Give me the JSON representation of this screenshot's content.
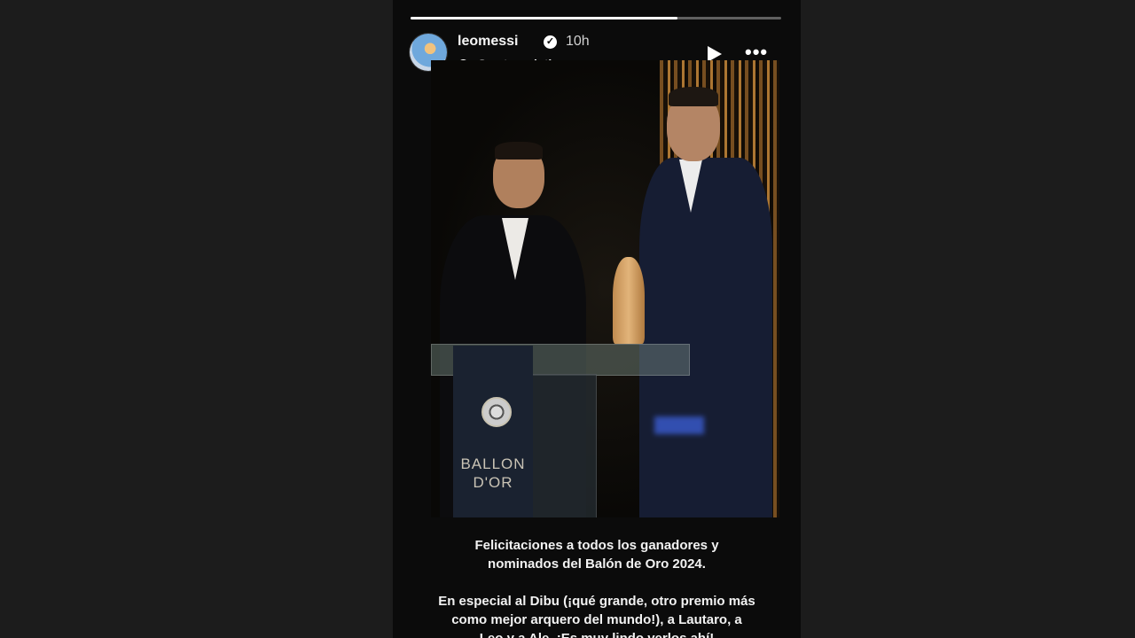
{
  "story": {
    "progress": 0.72,
    "user": {
      "username": "leomessi",
      "verified_icon": "verified-badge-icon",
      "time_ago": "10h"
    },
    "see_translation_label": "See translation",
    "photo": {
      "podium_text": "BALLON D'OR"
    },
    "caption": {
      "line1": "Felicitaciones a todos los ganadores y",
      "line2": "nominados del Balón de Oro 2024.",
      "line3": "En especial al Dibu (¡qué grande, otro premio más",
      "line4": "como mejor arquero del mundo!), a Lautaro, a",
      "line5": "Leo y a Ale. ¡Es muy lindo verlos ahí!"
    }
  },
  "colors": {
    "page_background": "#1c1c1c",
    "story_background": "#0b0b0b",
    "text": "#f2f2f2"
  }
}
